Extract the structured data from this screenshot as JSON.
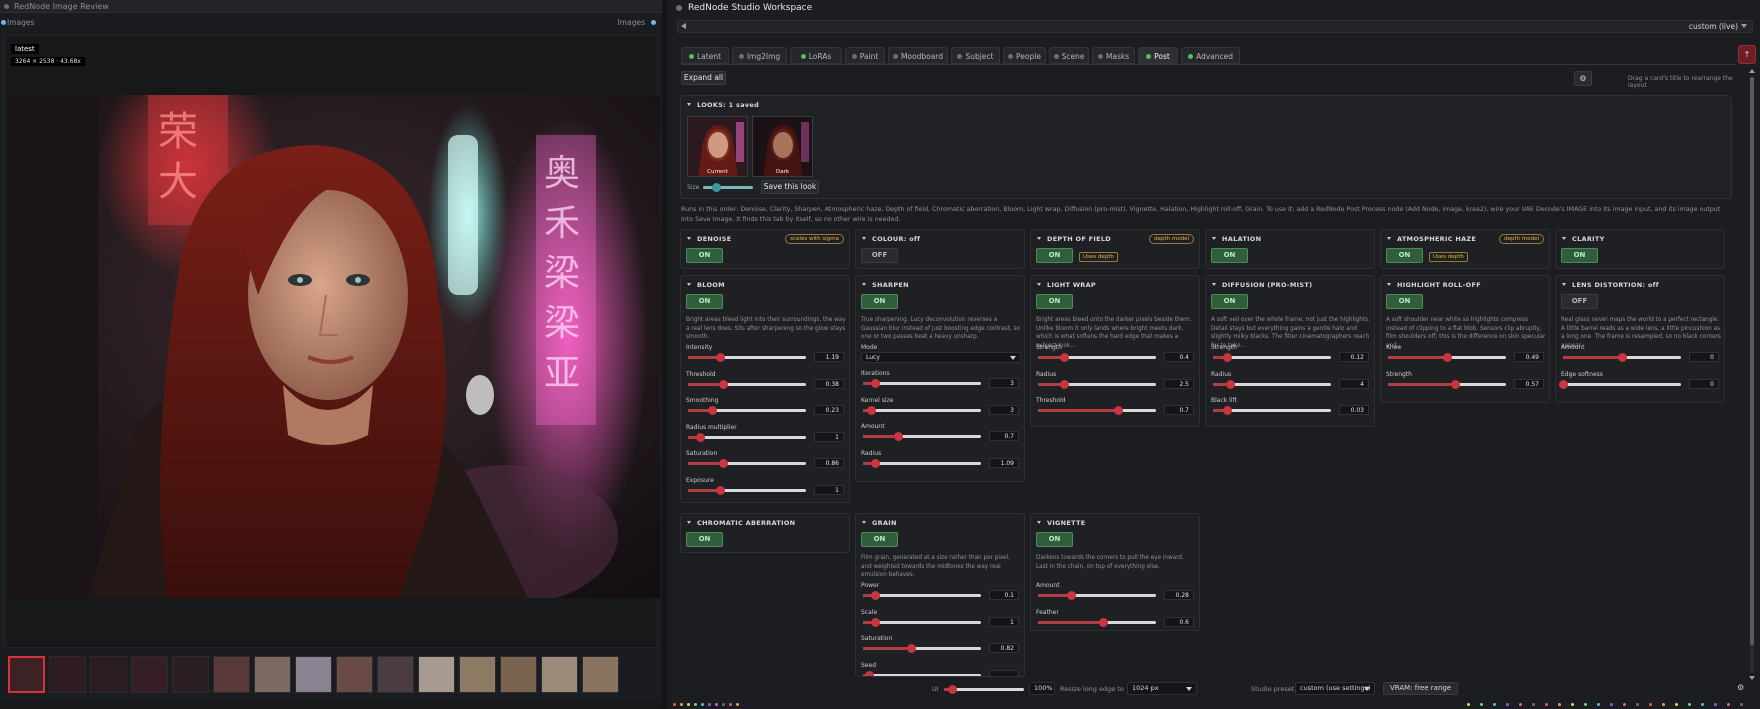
{
  "left": {
    "title": "RedNode Image Review",
    "sub_left": "Images",
    "sub_right": "Images",
    "image_name": "latest",
    "image_dims": "3264 × 2538 · 43.68x"
  },
  "right": {
    "title": "RedNode Studio Workspace",
    "preset_value": "custom (live)",
    "tabs": [
      {
        "label": "Latent",
        "dot": "#4fbf5f"
      },
      {
        "label": "Img2Img",
        "dot": "#6b6e73"
      },
      {
        "label": "LoRAs",
        "dot": "#4fbf5f"
      },
      {
        "label": "Paint",
        "dot": "#6b6e73"
      },
      {
        "label": "Moodboard",
        "dot": "#6b6e73"
      },
      {
        "label": "Subject",
        "dot": "#6b6e73"
      },
      {
        "label": "People",
        "dot": "#6b6e73"
      },
      {
        "label": "Scene",
        "dot": "#6b6e73"
      },
      {
        "label": "Masks",
        "dot": "#6b6e73"
      },
      {
        "label": "Post",
        "dot": "#4fbf5f"
      },
      {
        "label": "Advanced",
        "dot": "#4fbf5f"
      }
    ],
    "active_tab": "Post",
    "up_button": "↑",
    "expand_all": "Expand all",
    "gear_icon": "⚙",
    "hint": "Drag a card's title to rearrange the layout",
    "looks": {
      "heading": "LOOKS: 1 saved",
      "thumbs": [
        "Current",
        "Dark"
      ],
      "size_label": "Size",
      "size_value": 0.25,
      "save_button": "Save this look"
    },
    "long_desc": "Runs in this order: Denoise, Clarity, Sharpen, Atmospheric haze, Depth of field, Chromatic aberration, Bloom, Light wrap, Diffusion (pro-mist), Vignette, Halation, Highlight roll-off, Grain. To use it: add a RedNode Post Process node (Add Node, image, krea2), wire your VAE Decode's IMAGE into its image input, and its image output into Save Image. It finds this tab by itself, so no other wire is needed.",
    "cards": {
      "denoise": {
        "title": "DENOISE",
        "badge": "scales with sigma",
        "toggle": "ON"
      },
      "colour": {
        "title": "COLOUR: off",
        "toggle": "OFF"
      },
      "dof": {
        "title": "DEPTH OF FIELD",
        "badge": "depth model",
        "toggle": "ON",
        "uses": "Uses depth"
      },
      "halation": {
        "title": "HALATION",
        "toggle": "ON"
      },
      "haze": {
        "title": "ATMOSPHERIC HAZE",
        "badge": "depth model",
        "toggle": "ON",
        "uses": "Uses depth"
      },
      "clarity": {
        "title": "CLARITY",
        "toggle": "ON"
      },
      "bloom": {
        "title": "BLOOM",
        "toggle": "ON",
        "desc": "Bright areas bleed light into their surroundings, the way a real lens does. Sits after sharpening so the glow stays smooth.",
        "params": [
          {
            "label": "Intensity",
            "value": "1.19",
            "fill": 0.27
          },
          {
            "label": "Threshold",
            "value": "0.38",
            "fill": 0.3
          },
          {
            "label": "Smoothing",
            "value": "0.23",
            "fill": 0.2
          },
          {
            "label": "Radius multiplier",
            "value": "1",
            "fill": 0.1
          },
          {
            "label": "Saturation",
            "value": "0.86",
            "fill": 0.3
          },
          {
            "label": "Exposure",
            "value": "1",
            "fill": 0.27
          }
        ]
      },
      "sharpen": {
        "title": "SHARPEN",
        "toggle": "ON",
        "desc": "True sharpening. Lucy deconvolution reverses a Gaussian blur instead of just boosting edge contrast, so one or two passes beat a heavy unsharp.",
        "mode_label": "Mode",
        "mode_value": "Lucy",
        "params": [
          {
            "label": "Iterations",
            "value": "3",
            "fill": 0.1
          },
          {
            "label": "Kernel size",
            "value": "3",
            "fill": 0.07
          },
          {
            "label": "Amount",
            "value": "0.7",
            "fill": 0.3
          },
          {
            "label": "Radius",
            "value": "1.09",
            "fill": 0.1
          }
        ]
      },
      "lightwrap": {
        "title": "LIGHT WRAP",
        "toggle": "ON",
        "desc": "Bright areas bleed onto the darker pixels beside them. Unlike bloom it only lands where bright meets dark, which is what softens the hard edge that makes a subject look...",
        "params": [
          {
            "label": "Strength",
            "value": "0.4",
            "fill": 0.22
          },
          {
            "label": "Radius",
            "value": "2.5",
            "fill": 0.22
          },
          {
            "label": "Threshold",
            "value": "0.7",
            "fill": 0.68
          }
        ]
      },
      "diffusion": {
        "title": "DIFFUSION (PRO-MIST)",
        "toggle": "ON",
        "desc": "A soft veil over the whole frame, not just the highlights. Detail stays but everything gains a gentle halo and slightly milky blacks. The filter cinematographers reach for to take...",
        "params": [
          {
            "label": "Strength",
            "value": "0.12",
            "fill": 0.12
          },
          {
            "label": "Radius",
            "value": "4",
            "fill": 0.14
          },
          {
            "label": "Black lift",
            "value": "0.03",
            "fill": 0.12
          }
        ]
      },
      "rolloff": {
        "title": "HIGHLIGHT ROLL-OFF",
        "toggle": "ON",
        "desc": "A soft shoulder near white so highlights compress instead of clipping to a flat blob. Sensors clip abruptly, film shoulders off; this is the difference on skin specular and...",
        "params": [
          {
            "label": "Knee",
            "value": "0.49",
            "fill": 0.5
          },
          {
            "label": "Strength",
            "value": "0.57",
            "fill": 0.57
          }
        ]
      },
      "lens": {
        "title": "LENS DISTORTION: off",
        "toggle": "OFF",
        "desc": "Real glass never maps the world to a perfect rectangle. A little barrel reads as a wide lens, a little pincushion as a long one. The frame is resampled, so no black corners appear.",
        "params": [
          {
            "label": "Amount",
            "value": "0",
            "fill": 0.5
          },
          {
            "label": "Edge softness",
            "value": "0",
            "fill": 0.0
          }
        ]
      },
      "chroma": {
        "title": "CHROMATIC ABERRATION",
        "toggle": "ON"
      },
      "grain": {
        "title": "GRAIN",
        "toggle": "ON",
        "desc": "Film grain, generated at a size rather than per pixel, and weighted towards the midtones the way real emulsion behaves.",
        "params": [
          {
            "label": "Power",
            "value": "0.1",
            "fill": 0.1
          },
          {
            "label": "Scale",
            "value": "1",
            "fill": 0.1
          },
          {
            "label": "Saturation",
            "value": "0.82",
            "fill": 0.41
          },
          {
            "label": "Seed",
            "value": "",
            "fill": 0.05
          }
        ]
      },
      "vignette": {
        "title": "VIGNETTE",
        "toggle": "ON",
        "desc": "Darkens towards the corners to pull the eye inward. Last in the chain, on top of everything else.",
        "params": [
          {
            "label": "Amount",
            "value": "0.28",
            "fill": 0.28
          },
          {
            "label": "Feather",
            "value": "0.6",
            "fill": 0.55
          }
        ]
      }
    },
    "footer": {
      "ui_label": "UI",
      "ui_value": "100%",
      "ui_fill": 0.1,
      "resize_label": "Resize long edge to",
      "resize_value": "1024 px",
      "studio_label": "Studio preset",
      "studio_value": "custom (use settings)",
      "vram": "VRAM: free range",
      "gear_icon": "⚙"
    }
  }
}
